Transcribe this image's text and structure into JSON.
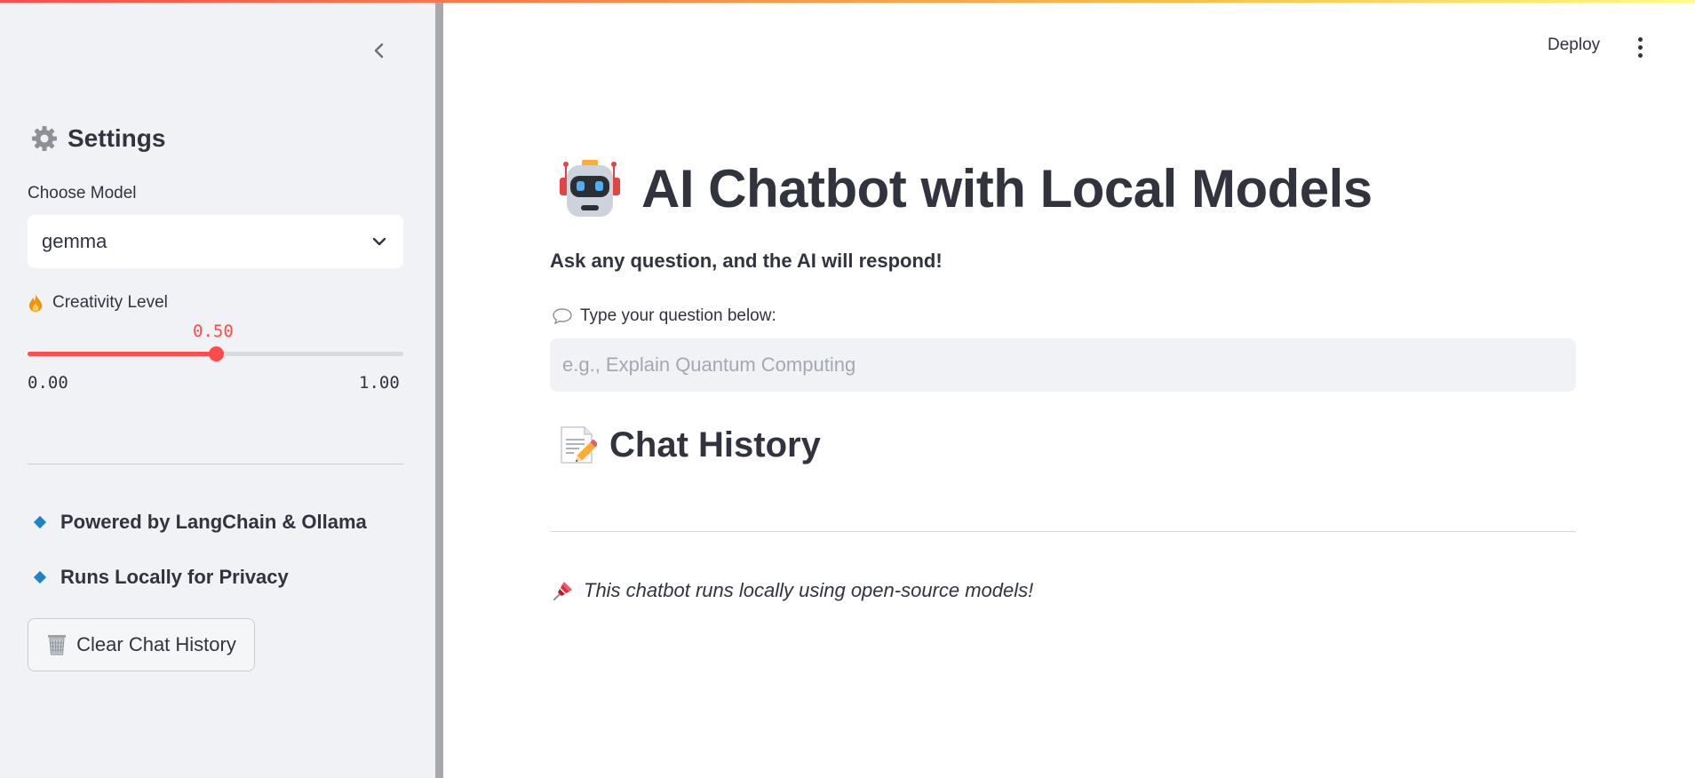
{
  "sidebar": {
    "settings_title": "Settings",
    "model_label": "Choose Model",
    "model_selected": "gemma",
    "creativity_label": "Creativity Level",
    "slider": {
      "value": 0.5,
      "value_text": "0.50",
      "min_text": "0.00",
      "max_text": "1.00"
    },
    "bullets": [
      {
        "text": "Powered by LangChain & Ollama"
      },
      {
        "text": "Runs Locally for Privacy"
      }
    ],
    "clear_button_label": "Clear Chat History"
  },
  "header": {
    "deploy_label": "Deploy"
  },
  "main": {
    "title": "AI Chatbot with Local Models",
    "subtitle": "Ask any question, and the AI will respond!",
    "question_label": "Type your question below:",
    "question_placeholder": "e.g., Explain Quantum Computing",
    "history_title": "Chat History",
    "footer_note": "This chatbot runs locally using open-source models!"
  },
  "colors": {
    "accent": "#ff4b4b",
    "sidebar_bg": "#f0f2f6",
    "text": "#31333f",
    "bullet_blue": "#1c83c8"
  },
  "icons": {
    "collapse": "chevron-left-icon",
    "settings": "gear-icon",
    "select": "chevron-down-icon",
    "creativity": "fire-icon",
    "bullet": "blue-diamond-icon",
    "clear": "wastebasket-icon",
    "menu": "kebab-menu-icon",
    "title": "robot-icon",
    "question": "speech-bubble-icon",
    "history": "memo-icon",
    "footer": "pushpin-icon"
  }
}
